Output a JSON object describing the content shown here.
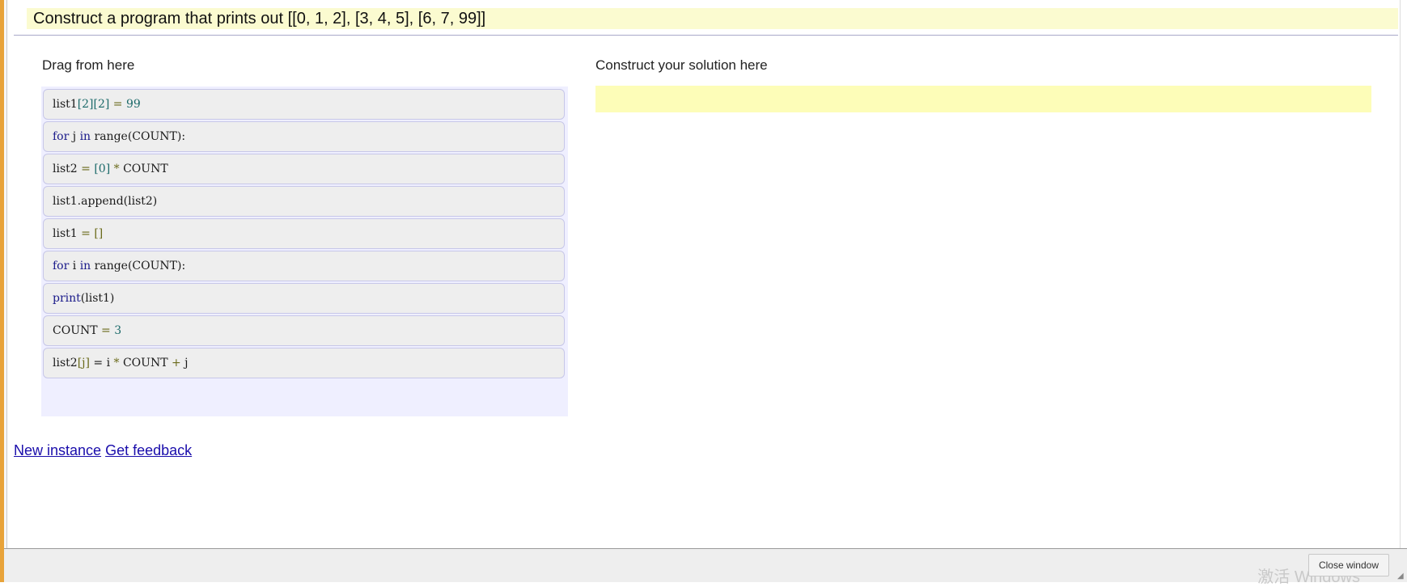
{
  "page": {
    "title": "Construct a program that prints out [[0, 1, 2], [3, 4, 5], [6, 7, 99]]"
  },
  "source": {
    "heading": "Drag from here",
    "blocks": [
      {
        "tokens": [
          {
            "t": "list1",
            "c": ""
          },
          {
            "t": "[2][2]",
            "c": "num"
          },
          {
            "t": " = ",
            "c": "op"
          },
          {
            "t": "99",
            "c": "num"
          }
        ]
      },
      {
        "tokens": [
          {
            "t": "for",
            "c": "kw"
          },
          {
            "t": " j ",
            "c": ""
          },
          {
            "t": "in",
            "c": "kw"
          },
          {
            "t": " range(COUNT):",
            "c": ""
          }
        ]
      },
      {
        "tokens": [
          {
            "t": "list2",
            "c": ""
          },
          {
            "t": " = ",
            "c": "op"
          },
          {
            "t": "[0]",
            "c": "num"
          },
          {
            "t": " * ",
            "c": "op"
          },
          {
            "t": "COUNT",
            "c": ""
          }
        ]
      },
      {
        "tokens": [
          {
            "t": "list1.append(list2)",
            "c": ""
          }
        ]
      },
      {
        "tokens": [
          {
            "t": "list1",
            "c": ""
          },
          {
            "t": " = ",
            "c": "op"
          },
          {
            "t": "[]",
            "c": "op"
          }
        ]
      },
      {
        "tokens": [
          {
            "t": "for",
            "c": "kw"
          },
          {
            "t": " i ",
            "c": ""
          },
          {
            "t": "in",
            "c": "kw"
          },
          {
            "t": " range(COUNT):",
            "c": ""
          }
        ]
      },
      {
        "tokens": [
          {
            "t": "print",
            "c": "kw"
          },
          {
            "t": "(list1)",
            "c": ""
          }
        ]
      },
      {
        "tokens": [
          {
            "t": "COUNT",
            "c": ""
          },
          {
            "t": " = ",
            "c": "op"
          },
          {
            "t": "3",
            "c": "num"
          }
        ]
      },
      {
        "tokens": [
          {
            "t": "list2",
            "c": ""
          },
          {
            "t": "[j]",
            "c": "op"
          },
          {
            "t": " = i ",
            "c": ""
          },
          {
            "t": "*",
            "c": "op"
          },
          {
            "t": " COUNT ",
            "c": ""
          },
          {
            "t": "+",
            "c": "op"
          },
          {
            "t": " j",
            "c": ""
          }
        ]
      }
    ]
  },
  "solution": {
    "heading": "Construct your solution here"
  },
  "links": {
    "new_instance": "New instance",
    "get_feedback": "Get feedback"
  },
  "footer": {
    "close_label": "Close window",
    "watermark": "激活 Windows"
  },
  "colors": {
    "accent_left_edge": "#e8a33a",
    "title_bg": "#fbfbd0",
    "source_bg": "#efefff",
    "target_bg": "#fdfdb8",
    "link": "#1a0dab"
  }
}
